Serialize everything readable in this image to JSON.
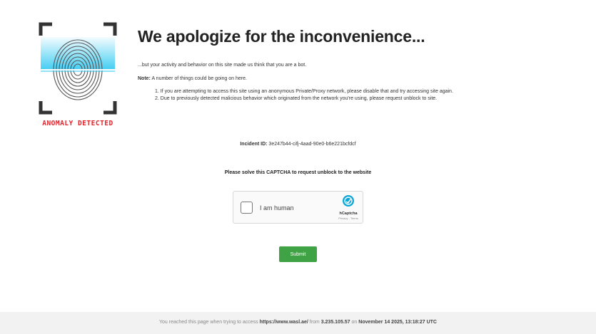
{
  "logo": {
    "caption": "ANOMALY DETECTED",
    "icon": "fingerprint-scan-icon"
  },
  "heading": "We apologize for the inconvenience...",
  "intro": "...but your activity and behavior on this site made us think that you are a bot.",
  "note": {
    "label": "Note:",
    "text": " A number of things could be going on here."
  },
  "reasons": [
    "1. If you are attempting to access this site using an anonymous Private/Proxy network, please disable that and try accessing site again.",
    "2. Due to previously detected malicious behavior which originated from the network you're using, please request unblock to site."
  ],
  "incident": {
    "label": "Incident ID:",
    "value": " 3e247b44-cifj-4aad-90e0-b6e221bcfdcf"
  },
  "captcha": {
    "title": "Please solve this CAPTCHA to request unblock to the website",
    "checkbox_label": "I am human",
    "brand": "hCaptcha",
    "links": "Privacy - Terms"
  },
  "submit_label": "Submit",
  "footer": {
    "prefix": "You reached this page when trying to access ",
    "url": "https://www.wasl.ae/",
    "from": " from ",
    "ip": "3.235.105.57",
    "on": " on ",
    "datetime": "November 14 2025, 13:18:27 UTC"
  },
  "colors": {
    "alert_red": "#e3242b",
    "submit_green": "#3fa244",
    "scan_cyan": "#22c4f0",
    "footer_bg": "#f2f2f2"
  }
}
